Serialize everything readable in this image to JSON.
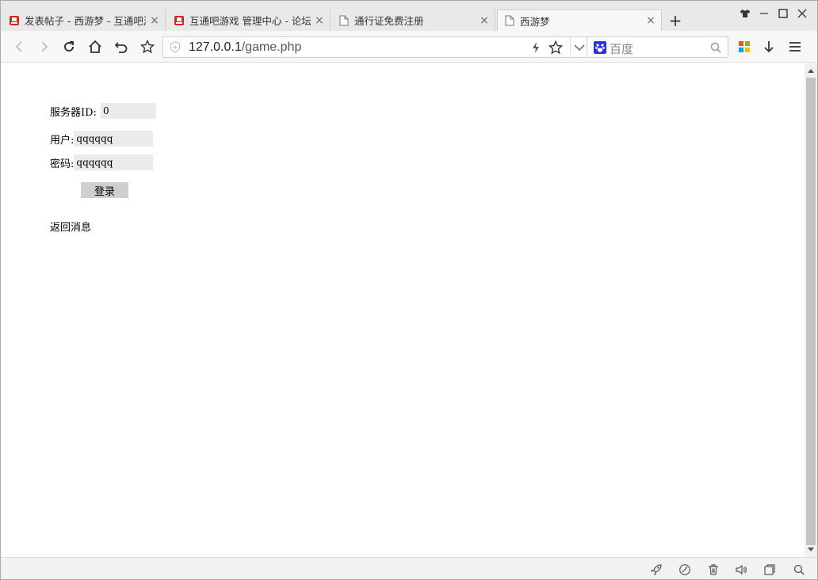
{
  "tabs": [
    {
      "title": "发表帖子 - 西游梦 - 互通吧游",
      "icon": "site-favicon-icon",
      "active": false
    },
    {
      "title": "互通吧游戏 管理中心 - 论坛",
      "icon": "site-favicon-icon",
      "active": false
    },
    {
      "title": "通行证免费注册",
      "icon": "page-icon",
      "active": false
    },
    {
      "title": "西游梦",
      "icon": "page-icon",
      "active": true
    }
  ],
  "toolbar": {
    "url_host": "127.0.0.1",
    "url_path": "/game.php",
    "search_placeholder": "百度"
  },
  "form": {
    "server_label": "服务器ID:",
    "server_value": "0",
    "user_label": "用户:",
    "user_value": "qqqqqq",
    "password_label": "密码:",
    "password_value": "qqqqqq",
    "login_label": "登录",
    "message": "返回消息"
  },
  "colors": {
    "tab_bg": "#e9e9e9",
    "toolbar_bg": "#f7f7f7",
    "input_bg": "#ebebeb",
    "button_bg": "#cfcfcf",
    "favicon_red": "#d9261c"
  }
}
